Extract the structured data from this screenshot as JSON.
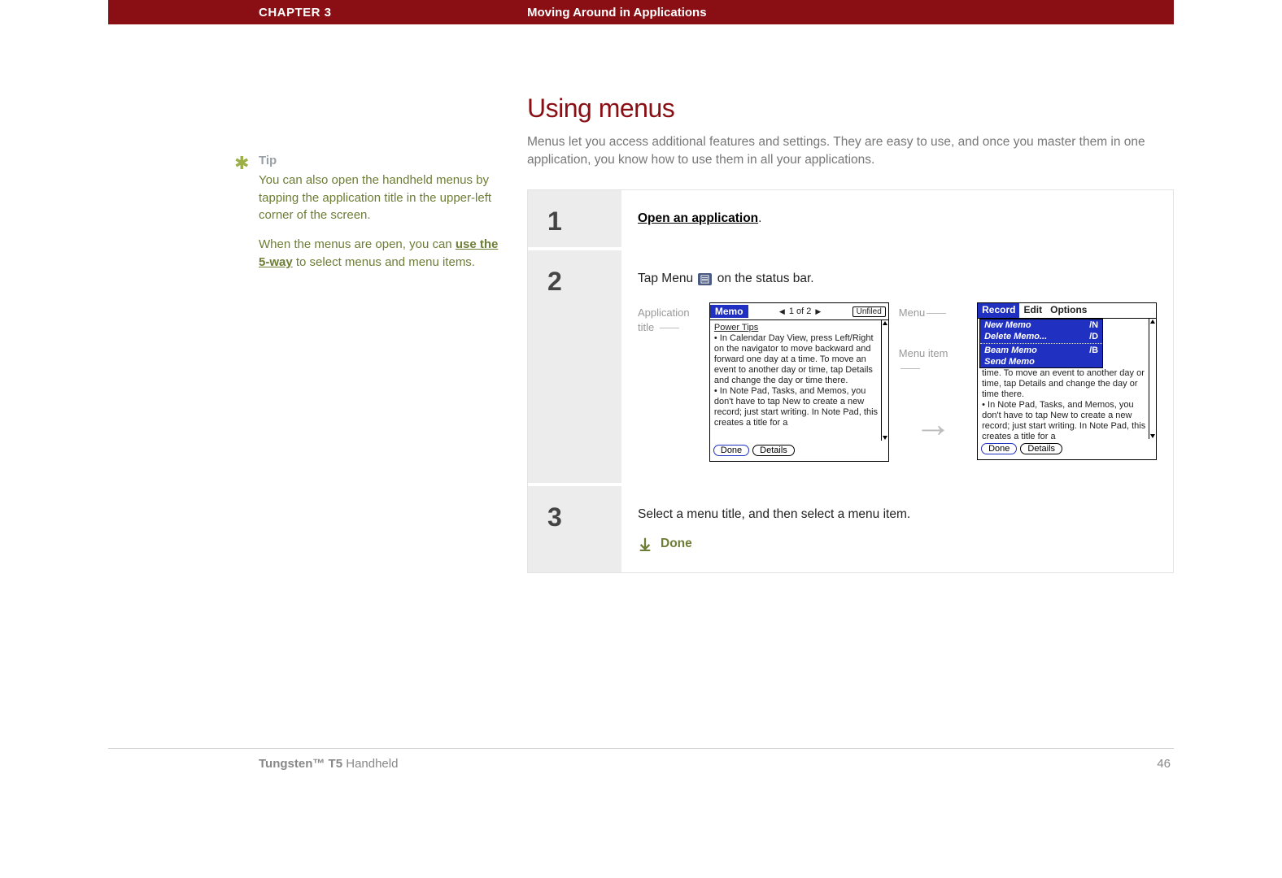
{
  "header": {
    "chapter": "CHAPTER 3",
    "title": "Moving Around in Applications"
  },
  "section_title": "Using menus",
  "intro": "Menus let you access additional features and settings. They are easy to use, and once you master them in one application, you know how to use them in all your applications.",
  "tip": {
    "label": "Tip",
    "p1": "You can also open the handheld menus by tapping the application title in the upper-left corner of the screen.",
    "p2_a": "When the menus are open, you can ",
    "p2_link": "use the 5-way",
    "p2_b": " to select menus and menu items."
  },
  "steps": {
    "s1": {
      "num": "1",
      "link": "Open an application",
      "after": "."
    },
    "s2": {
      "num": "2",
      "text_a": "Tap Menu ",
      "text_b": " on the status bar.",
      "callout_left": "Application title",
      "callout_menu": "Menu",
      "callout_item": "Menu item",
      "palm": {
        "tag": "Memo",
        "pager": "1 of 2",
        "category": "Unfiled",
        "body_title": "Power Tips",
        "body_text": "• In Calendar Day View, press Left/Right on the navigator to move backward and forward one day at a time. To move an event to another day or time, tap Details and change the day or time there.\n• In Note Pad, Tasks, and Memos, you don't have to tap New to create a new record; just start writing. In Note Pad, this creates a title for a",
        "btn_done": "Done",
        "btn_details": "Details"
      },
      "palm2": {
        "menu_record": "Record",
        "menu_edit": "Edit",
        "menu_options": "Options",
        "items": {
          "new": {
            "label": "New Memo",
            "sc": "/N"
          },
          "del": {
            "label": "Delete Memo...",
            "sc": "/D"
          },
          "beam": {
            "label": "Beam Memo",
            "sc": "/B"
          },
          "send": {
            "label": "Send Memo",
            "sc": ""
          }
        },
        "bg_text": "time. To move an event to another day or time, tap Details and change the day or time there.\n• In Note Pad, Tasks, and Memos, you don't have to tap New to create a new record; just start writing. In Note Pad, this creates a title for a"
      }
    },
    "s3": {
      "num": "3",
      "text": "Select a menu title, and then select a menu item.",
      "done": "Done"
    }
  },
  "footer": {
    "product_bold": "Tungsten™ T5",
    "product_rest": " Handheld",
    "page": "46"
  }
}
